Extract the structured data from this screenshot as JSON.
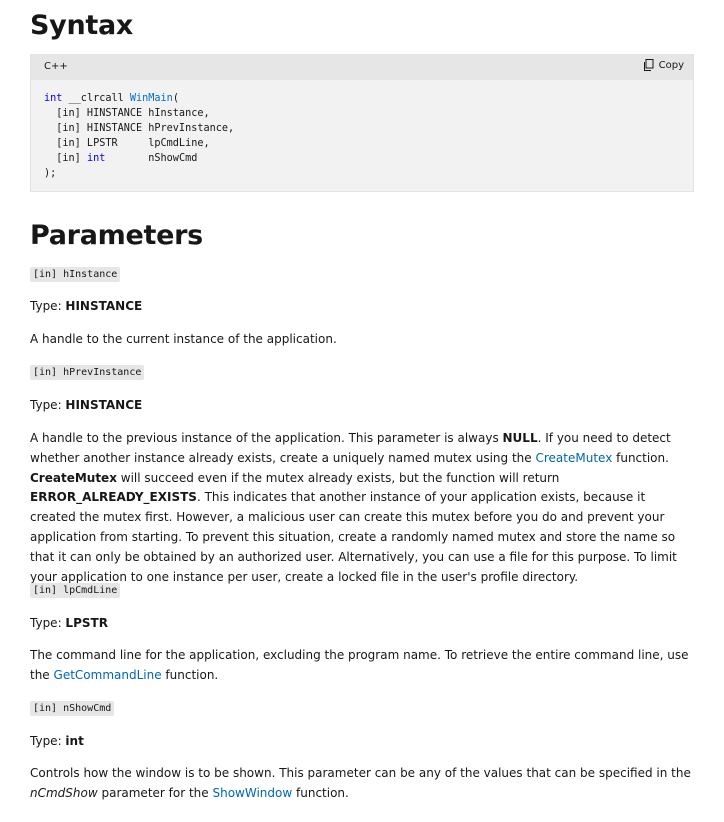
{
  "syntax_heading": "Syntax",
  "code_block": {
    "language": "C++",
    "copy_label": "Copy",
    "lines": [
      {
        "kw": "int",
        "pre": " __clrcall ",
        "fn": "WinMain",
        "post": "("
      },
      {
        "text": "  [in] HINSTANCE hInstance,"
      },
      {
        "text": "  [in] HINSTANCE hPrevInstance,"
      },
      {
        "text": "  [in] LPSTR     lpCmdLine,"
      },
      {
        "pre": "  [in] ",
        "kw": "int",
        "post": "       nShowCmd"
      },
      {
        "text": ");"
      }
    ]
  },
  "parameters_heading": "Parameters",
  "params": [
    {
      "signature": "[in] hInstance",
      "type_prefix": "Type: ",
      "type": "HINSTANCE",
      "description": "A handle to the current instance of the application."
    },
    {
      "signature": "[in] hPrevInstance",
      "type_prefix": "Type: ",
      "type": "HINSTANCE",
      "description_parts": {
        "t1": "A handle to the previous instance of the application. This parameter is always ",
        "b1": "NULL",
        "t2": ". If you need to detect whether another instance already exists, create a uniquely named mutex using the ",
        "link1": "CreateMutex",
        "t3": " function. ",
        "b2": "CreateMutex",
        "t4": " will succeed even if the mutex already exists, but the function will return ",
        "b3": "ERROR_ALREADY_EXISTS",
        "t5": ". This indicates that another instance of your application exists, because it created the mutex first. However, a malicious user can create this mutex before you do and prevent your application from starting. To prevent this situation, create a randomly named mutex and store the name so that it can only be obtained by an authorized user. Alternatively, you can use a file for this purpose. To limit your application to one instance per user, create a locked file in the user's profile directory."
      }
    },
    {
      "signature": "[in] lpCmdLine",
      "type_prefix": "Type: ",
      "type": "LPSTR",
      "description_parts": {
        "t1": "The command line for the application, excluding the program name. To retrieve the entire command line, use the ",
        "link1": "GetCommandLine",
        "t2": " function."
      }
    },
    {
      "signature": "[in] nShowCmd",
      "type_prefix": "Type: ",
      "type": "int",
      "description_parts": {
        "t1": "Controls how the window is to be shown. This parameter can be any of the values that can be specified in the ",
        "i1": "nCmdShow",
        "t2": " parameter for the ",
        "link1": "ShowWindow",
        "t3": " function."
      }
    }
  ]
}
